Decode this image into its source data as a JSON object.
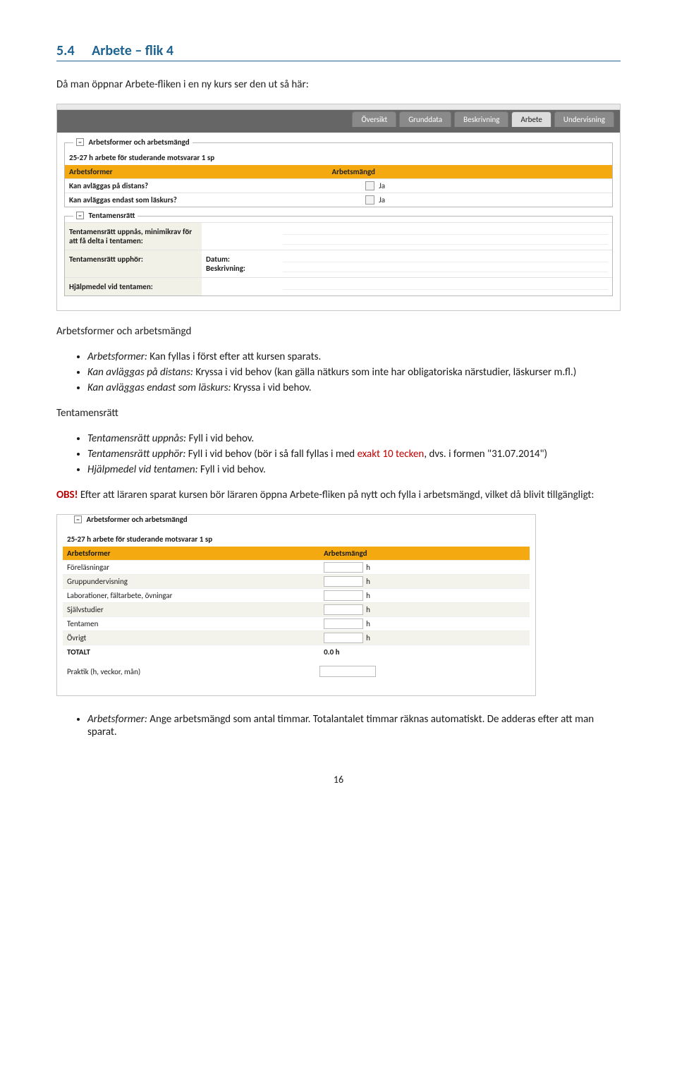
{
  "heading": {
    "num": "5.4",
    "title": "Arbete – flik 4"
  },
  "intro": "Då man öppnar Arbete-fliken i en ny kurs ser den ut så här:",
  "tabs": [
    "Översikt",
    "Grunddata",
    "Beskrivning",
    "Arbete",
    "Undervisning"
  ],
  "active_tab_index": 3,
  "shot1": {
    "fset_title": "Arbetsformer och arbetsmängd",
    "note": "25-27 h arbete för studerande motsvarar 1 sp",
    "col1": "Arbetsformer",
    "col2": "Arbetsmängd",
    "rows": [
      {
        "label": "Kan avläggas på distans?",
        "opt": "Ja"
      },
      {
        "label": "Kan avläggas endast som läskurs?",
        "opt": "Ja"
      }
    ],
    "tent_title": "Tentamensrätt",
    "tent_r1": "Tentamensrätt uppnås, minimikrav för att få delta i tentamen:",
    "tent_r2_label": "Tentamensrätt upphör:",
    "tent_r2_datum": "Datum:",
    "tent_r2_besk": "Beskrivning:",
    "tent_r3": "Hjälpmedel vid tentamen:"
  },
  "body": {
    "h1": "Arbetsformer och arbetsmängd",
    "b1_pre": "Arbetsformer:",
    "b1_post": " Kan fyllas i först efter att kursen sparats.",
    "b2_pre": "Kan avläggas på distans:",
    "b2_post": " Kryssa i vid behov (kan gälla nätkurs som inte har obligatoriska närstudier, läskurser m.fl.)",
    "b3_pre": "Kan avläggas endast som läskurs:",
    "b3_post": " Kryssa i vid behov.",
    "h2": "Tentamensrätt",
    "t1_pre": "Tentamensrätt uppnås:",
    "t1_post": " Fyll i vid behov.",
    "t2_pre": "Tentamensrätt upphör:",
    "t2_mid": " Fyll i vid behov (bör i så fall fyllas i med ",
    "t2_red": "exakt 10 tecken",
    "t2_post": ", dvs. i formen \"31.07.2014\")",
    "t3_pre": "Hjälpmedel vid tentamen:",
    "t3_post": " Fyll i vid behov.",
    "obs_label": "OBS!",
    "obs_post": " Efter att läraren sparat kursen bör läraren öppna Arbete-fliken på nytt och fylla i arbetsmängd, vilket då blivit tillgängligt:"
  },
  "shot2": {
    "fset_title": "Arbetsformer och arbetsmängd",
    "note": "25-27 h arbete för studerande motsvarar 1 sp",
    "col1": "Arbetsformer",
    "col2": "Arbetsmängd",
    "rows": [
      "Föreläsningar",
      "Gruppundervisning",
      "Laborationer, fältarbete, övningar",
      "Självstudier",
      "Tentamen",
      "Övrigt"
    ],
    "unit": "h",
    "totalt_label": "TOTALT",
    "totalt_value": "0.0 h",
    "praktik": "Praktik (h, veckor, mån)"
  },
  "footer": {
    "b_pre": "Arbetsformer:",
    "b_post": "  Ange arbetsmängd som antal timmar. Totalantalet timmar räknas automatiskt. De adderas efter att man sparat."
  },
  "page_number": "16"
}
